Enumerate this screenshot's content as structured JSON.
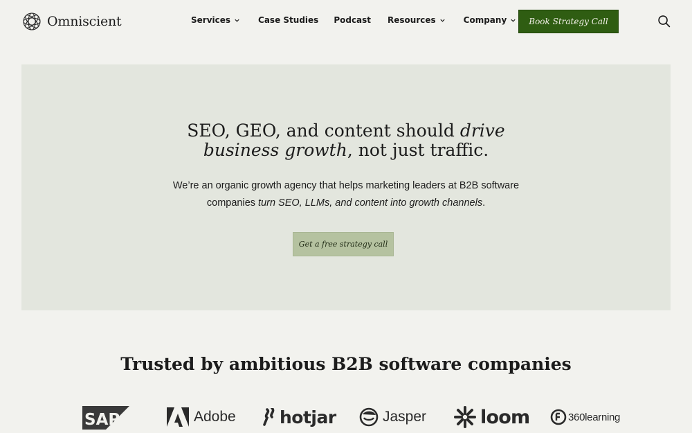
{
  "nav": {
    "brand": "Omniscient",
    "items": [
      {
        "label": "Services"
      },
      {
        "label": "Case Studies"
      },
      {
        "label": "Podcast"
      },
      {
        "label": "Resources"
      },
      {
        "label": "Company"
      }
    ],
    "cta": "Book Strategy Call",
    "search_icon": "search-icon"
  },
  "hero": {
    "title_a": "SEO, GEO, and content should ",
    "title_b": "drive",
    "title_c": "business growth",
    "title_d": ", not just traffic.",
    "sub_a": "We’re an organic growth agency that helps marketing leaders at B2B software",
    "sub_b": "companies ",
    "sub_c": "turn SEO, LLMs, and content into growth channels",
    "sub_d": ".",
    "cta": "Get a free strategy call"
  },
  "trusted": {
    "heading": "Trusted by ambitious B2B software companies",
    "logos": [
      "SAP",
      "Adobe",
      "hotjar",
      "Jasper",
      "loom",
      "360learning"
    ]
  },
  "colors": {
    "page_bg": "#f2f2ee",
    "hero_bg": "#e3e6de",
    "primary_cta": "#2f5d12",
    "secondary_cta": "#b5c2a0"
  }
}
